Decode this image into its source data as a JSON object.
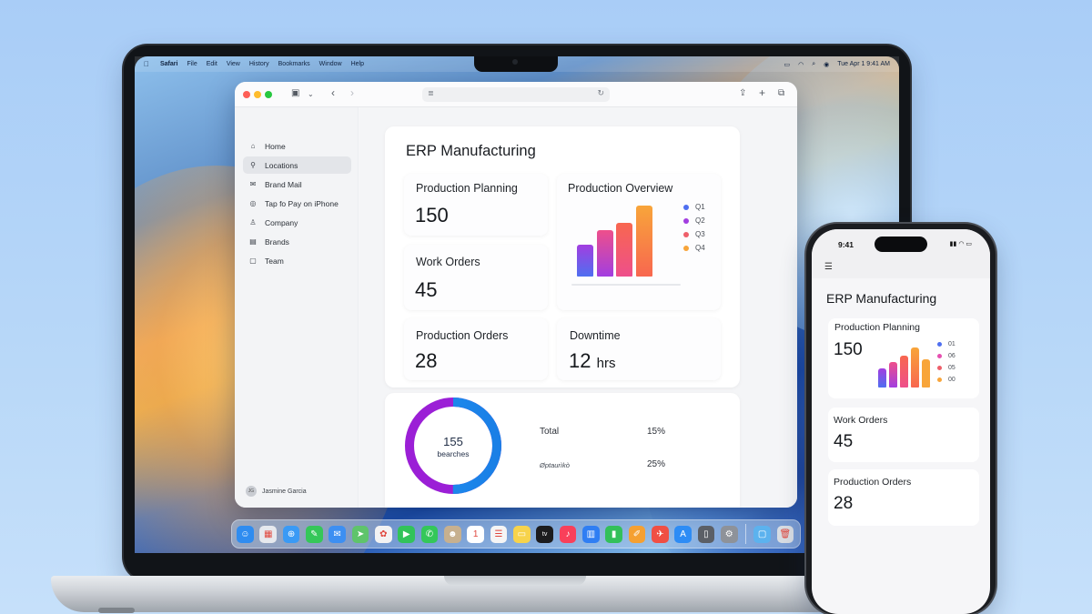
{
  "menubar": {
    "app": "Safari",
    "items": [
      "File",
      "Edit",
      "View",
      "History",
      "Bookmarks",
      "Window",
      "Help"
    ],
    "datetime": "Tue Apr 1  9:41 AM"
  },
  "sidebar": {
    "items": [
      {
        "label": "Home",
        "icon": "house-icon"
      },
      {
        "label": "Locations",
        "icon": "location-pin-icon"
      },
      {
        "label": "Brand Mail",
        "icon": "mail-icon"
      },
      {
        "label": "Tap fo Pay on iPhone",
        "icon": "tap-to-pay-icon"
      },
      {
        "label": "Company",
        "icon": "person-icon"
      },
      {
        "label": "Brands",
        "icon": "archive-box-icon"
      },
      {
        "label": "Team",
        "icon": "note-icon"
      }
    ],
    "active_index": 1,
    "user": {
      "initials": "JG",
      "name": "Jasmine Garcia"
    }
  },
  "dashboard": {
    "title": "ERP Manufacturing",
    "production_planning": {
      "label": "Production Planning",
      "value": "150"
    },
    "work_orders": {
      "label": "Work Orders",
      "value": "45"
    },
    "production_orders": {
      "label": "Production Orders",
      "value": "28"
    },
    "downtime": {
      "label": "Downtime",
      "value": "12",
      "unit": "hrs"
    },
    "overview": {
      "label": "Production Overview"
    }
  },
  "stats": {
    "donut": {
      "value": "155",
      "label": "bearches",
      "fraction": 0.5
    },
    "rows": [
      {
        "label": "Total",
        "value": "15%"
      },
      {
        "label": "Øptaurìkò",
        "value": "25%"
      }
    ]
  },
  "chart_data": [
    {
      "type": "bar",
      "categories": [
        "Q1",
        "Q2",
        "Q3",
        "Q4"
      ],
      "series": [
        {
          "values": [
            33,
            48,
            56,
            74
          ]
        }
      ],
      "colors": [
        "#4f6ff0",
        "#a23ee0",
        "#ee4f8b",
        "#f8a53a"
      ],
      "legend": [
        "Q1",
        "Q2",
        "Q3",
        "Q4"
      ],
      "legend_position": "right"
    },
    {
      "type": "bar",
      "categories": [
        "01",
        "06",
        "05",
        "00"
      ],
      "series": [
        {
          "values": [
            18,
            24,
            30,
            38,
            27
          ]
        }
      ],
      "colors": [
        "#4f6ff0",
        "#a23ee0",
        "#ee4f8b",
        "#f8a53a"
      ],
      "legend": [
        "01",
        "06",
        "05",
        "00"
      ],
      "legend_position": "right"
    }
  ],
  "phone": {
    "time": "9:41",
    "status": "▮▮ ◠ ▭",
    "title": "ERP Manufacturing",
    "cards": [
      {
        "label": "Production Planning",
        "value": "150"
      },
      {
        "label": "Work Orders",
        "value": "45"
      },
      {
        "label": "Production Orders",
        "value": "28"
      }
    ]
  },
  "dock": {
    "apps": [
      {
        "name": "finder-icon",
        "color": "#2f8cf0"
      },
      {
        "name": "launchpad-icon",
        "color": "#e6e9ee"
      },
      {
        "name": "safari-icon",
        "color": "#3a9af5"
      },
      {
        "name": "messages-icon",
        "color": "#35c759"
      },
      {
        "name": "mail-icon",
        "color": "#3d8ff2"
      },
      {
        "name": "maps-icon",
        "color": "#5fc46b"
      },
      {
        "name": "photos-icon",
        "color": "#f3f3f3"
      },
      {
        "name": "facetime-icon",
        "color": "#32c35a"
      },
      {
        "name": "phone-icon",
        "color": "#34c759"
      },
      {
        "name": "contacts-icon",
        "color": "#c7b08f"
      },
      {
        "name": "calendar-icon",
        "color": "#ffffff"
      },
      {
        "name": "reminders-icon",
        "color": "#f5f5f5"
      },
      {
        "name": "notes-icon",
        "color": "#f7d34b"
      },
      {
        "name": "tv-icon",
        "color": "#1c1c1e"
      },
      {
        "name": "music-icon",
        "color": "#f9405a"
      },
      {
        "name": "keynote-icon",
        "color": "#2f7ef3"
      },
      {
        "name": "numbers-icon",
        "color": "#33c05a"
      },
      {
        "name": "pages-icon",
        "color": "#f5a031"
      },
      {
        "name": "launch-icon",
        "color": "#f04f44"
      },
      {
        "name": "app-store-icon",
        "color": "#2d8cf5"
      },
      {
        "name": "iphone-mirroring-icon",
        "color": "#5b5f66"
      },
      {
        "name": "settings-icon",
        "color": "#8e9299"
      },
      {
        "name": "downloads-folder-icon",
        "color": "#5cb2ee"
      },
      {
        "name": "trash-icon",
        "color": "#d8dde3"
      }
    ]
  }
}
